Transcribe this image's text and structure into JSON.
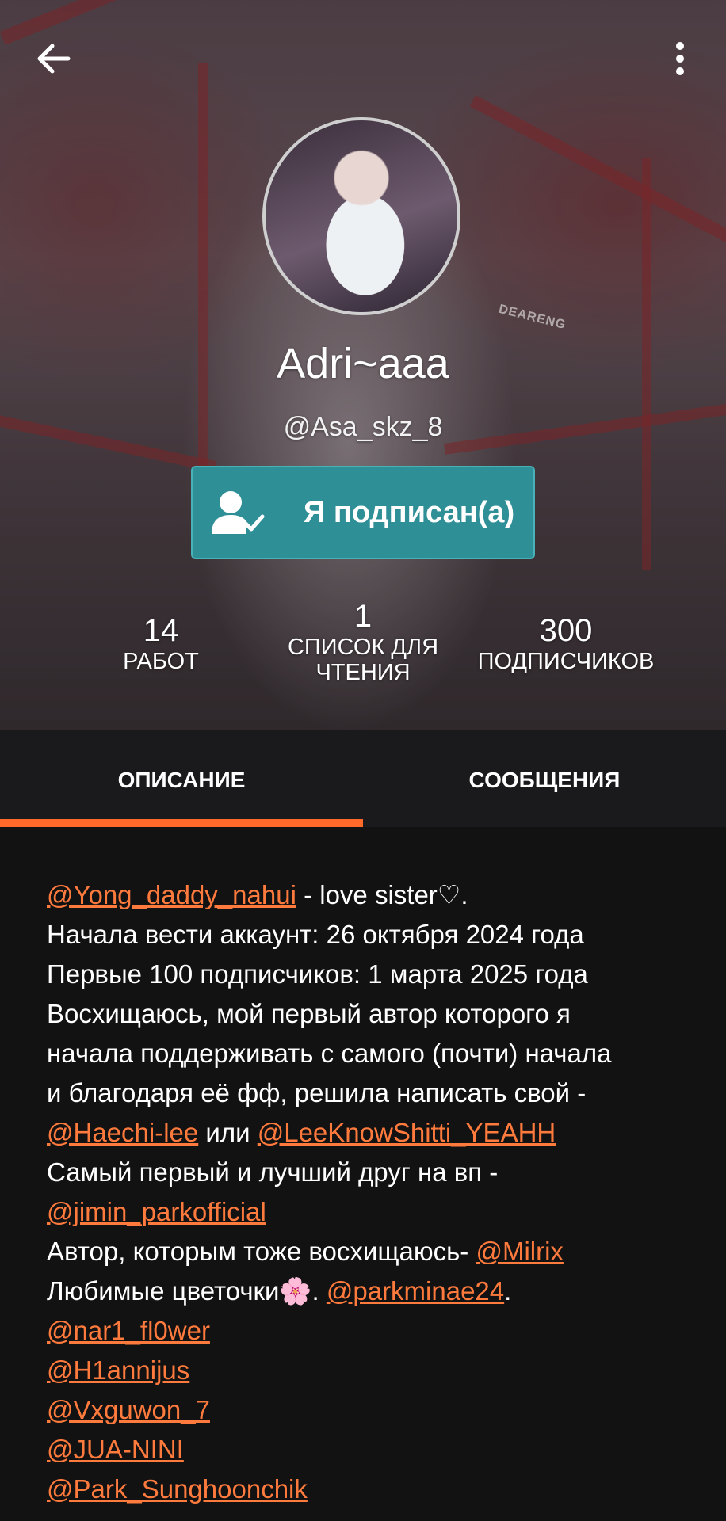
{
  "header": {
    "watermark": "DEARENG",
    "display_name": "Adri~aaa",
    "username": "@Asa_skz_8",
    "follow_button_label": "Я подписан(а)"
  },
  "stats": {
    "works": {
      "value": "14",
      "label": "РАБОТ"
    },
    "reading_lists": {
      "value": "1",
      "label_line1": "СПИСОК ДЛЯ",
      "label_line2": "ЧТЕНИЯ"
    },
    "followers": {
      "value": "300",
      "label": "ПОДПИСЧИКОВ"
    }
  },
  "tabs": {
    "description": "ОПИСАНИЕ",
    "messages": "СООБЩЕНИЯ",
    "active": "description"
  },
  "colors": {
    "accent": "#ff6a2b",
    "mention": "#ff7a3d",
    "follow_button": "#2f8f96",
    "background": "#121212"
  },
  "description": {
    "l1_mention": "@Yong_daddy_nahui",
    "l1_text": " - love sister♡.",
    "l2": "Начала вести аккаунт: 26 октября 2024 года",
    "l3": "Первые 100 подписчиков: 1 марта 2025 года",
    "l4": "Восхищаюсь, мой первый автор которого я",
    "l5": "начала поддерживать с самого (почти) начала",
    "l6": "и благодаря её фф, решила написать свой -",
    "l7_mention_a": "@Haechi-lee",
    "l7_text": " или ",
    "l7_mention_b": "@LeeKnowShitti_YEAHH",
    "l8": "Самый первый и лучший друг на вп -",
    "l9_mention": "@jimin_parkofficial",
    "l10_text": "Автор, которым тоже восхищаюсь- ",
    "l10_mention": "@Milrix",
    "l11_text": "Любимые цветочки🌸. ",
    "l11_mention": "@parkminae24",
    "l11_end": ".",
    "list_mentions": [
      "@nar1_fl0wer",
      "@H1annijus",
      "@Vxguwon_7",
      "@JUA-NINI",
      "@Park_Sunghoonchik"
    ]
  },
  "icons": {
    "back": "arrow-left-icon",
    "menu": "more-vertical-icon",
    "follow": "user-check-icon"
  }
}
